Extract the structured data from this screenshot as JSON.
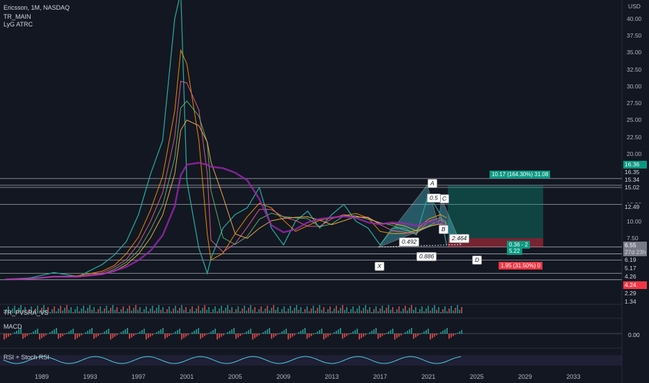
{
  "legend": {
    "title": "Ericsson, 1M, NASDAQ",
    "line2": "TR_MAIN",
    "line3": "LyG ATRC"
  },
  "currency": "USD",
  "panes": {
    "volume": "TR_PVSRA_VS",
    "macd": "MACD",
    "rsi": "RSI + Stoch RSI"
  },
  "macd_value": "0.00",
  "price_axis": [
    "40.00",
    "37.50",
    "35.00",
    "32.50",
    "30.00",
    "27.50",
    "25.00",
    "22.50",
    "20.00",
    "17.50",
    "15.00",
    "12.50",
    "10.00",
    "7.50"
  ],
  "right_tags": [
    {
      "text": "16.36",
      "bg": "#089981",
      "fg": "#ffffff"
    },
    {
      "text": "16.35",
      "bg": "#131722",
      "fg": "#d1d4dc"
    },
    {
      "text": "15.34",
      "bg": "#131722",
      "fg": "#d1d4dc"
    },
    {
      "text": "15.02",
      "bg": "#131722",
      "fg": "#d1d4dc"
    },
    {
      "text": "12.49",
      "bg": "#131722",
      "fg": "#d1d4dc"
    },
    {
      "text": "6.55",
      "bg": "#787b86",
      "fg": "#ffffff"
    },
    {
      "text": "27d 23h",
      "bg": "#787b86",
      "fg": "#d1d4dc"
    },
    {
      "text": "6.19",
      "bg": "#131722",
      "fg": "#d1d4dc"
    },
    {
      "text": "5.17",
      "bg": "#131722",
      "fg": "#d1d4dc"
    },
    {
      "text": "4.26",
      "bg": "#131722",
      "fg": "#d1d4dc"
    },
    {
      "text": "4.24",
      "bg": "#f23645",
      "fg": "#ffffff"
    },
    {
      "text": "2.29",
      "bg": "#131722",
      "fg": "#d1d4dc"
    },
    {
      "text": "1.34",
      "bg": "#131722",
      "fg": "#d1d4dc"
    }
  ],
  "x_axis": [
    "1989",
    "1993",
    "1997",
    "2001",
    "2005",
    "2009",
    "2013",
    "2017",
    "2021",
    "2025",
    "2029",
    "2033"
  ],
  "pattern": {
    "points": {
      "X": "X",
      "A": "A",
      "B": "B",
      "C": "C",
      "D": "D"
    },
    "ratios": {
      "xb": "0.492",
      "ac": "0.5",
      "bd": "2.464",
      "xd": "0.886"
    }
  },
  "position": {
    "profit_label": "10.17 (164.30%) 31.08",
    "mid_label_1": "0.36 - 2",
    "mid_label_2": "5.22",
    "loss_label": "1.95 (31.50%) 0"
  },
  "colors": {
    "background": "#131722",
    "profit": "#089981",
    "loss": "#f23645",
    "harmonic": "#4dd0e1",
    "ma_purple": "#9c27b0",
    "ma_orange": "#ff9800"
  },
  "chart_data": {
    "type": "line",
    "title": "Ericsson, 1M, NASDAQ",
    "x": [
      1986,
      1988,
      1990,
      1992,
      1994,
      1995,
      1996,
      1997,
      1998,
      1999,
      2000,
      2000.5,
      2001,
      2002,
      2002.7,
      2003,
      2004,
      2005,
      2006,
      2007,
      2008,
      2009,
      2010,
      2011,
      2012,
      2013,
      2014,
      2015,
      2016,
      2017,
      2018,
      2019,
      2020,
      2021,
      2022,
      2022.5
    ],
    "series": [
      {
        "values": [
          1.4,
          1.6,
          2.4,
          1.8,
          3.6,
          5,
          7,
          11,
          17,
          22,
          40,
          44,
          16,
          6,
          2.29,
          4.5,
          9,
          11,
          12,
          15,
          9,
          6.5,
          10,
          11.5,
          9,
          11,
          12.5,
          10,
          9,
          6.5,
          9,
          9,
          8,
          14,
          11,
          6.55
        ]
      }
    ],
    "ylim": [
      1,
      44
    ],
    "xlim": [
      1986,
      2036
    ],
    "levels": [
      16.35,
      15.34,
      15.02,
      12.49,
      6.19,
      5.17,
      4.26,
      2.29,
      1.34
    ],
    "harmonic": {
      "X": [
        2016.9,
        6.19
      ],
      "A": [
        2020.9,
        15.34
      ],
      "B": [
        2021.8,
        9.7
      ],
      "C": [
        2022.1,
        13.3
      ],
      "D": [
        2023.7,
        6.55
      ]
    },
    "position_box": {
      "from": 2022.6,
      "to": 2030.5,
      "entry": 7.5,
      "target": 15.34,
      "stop": 6.19
    }
  }
}
